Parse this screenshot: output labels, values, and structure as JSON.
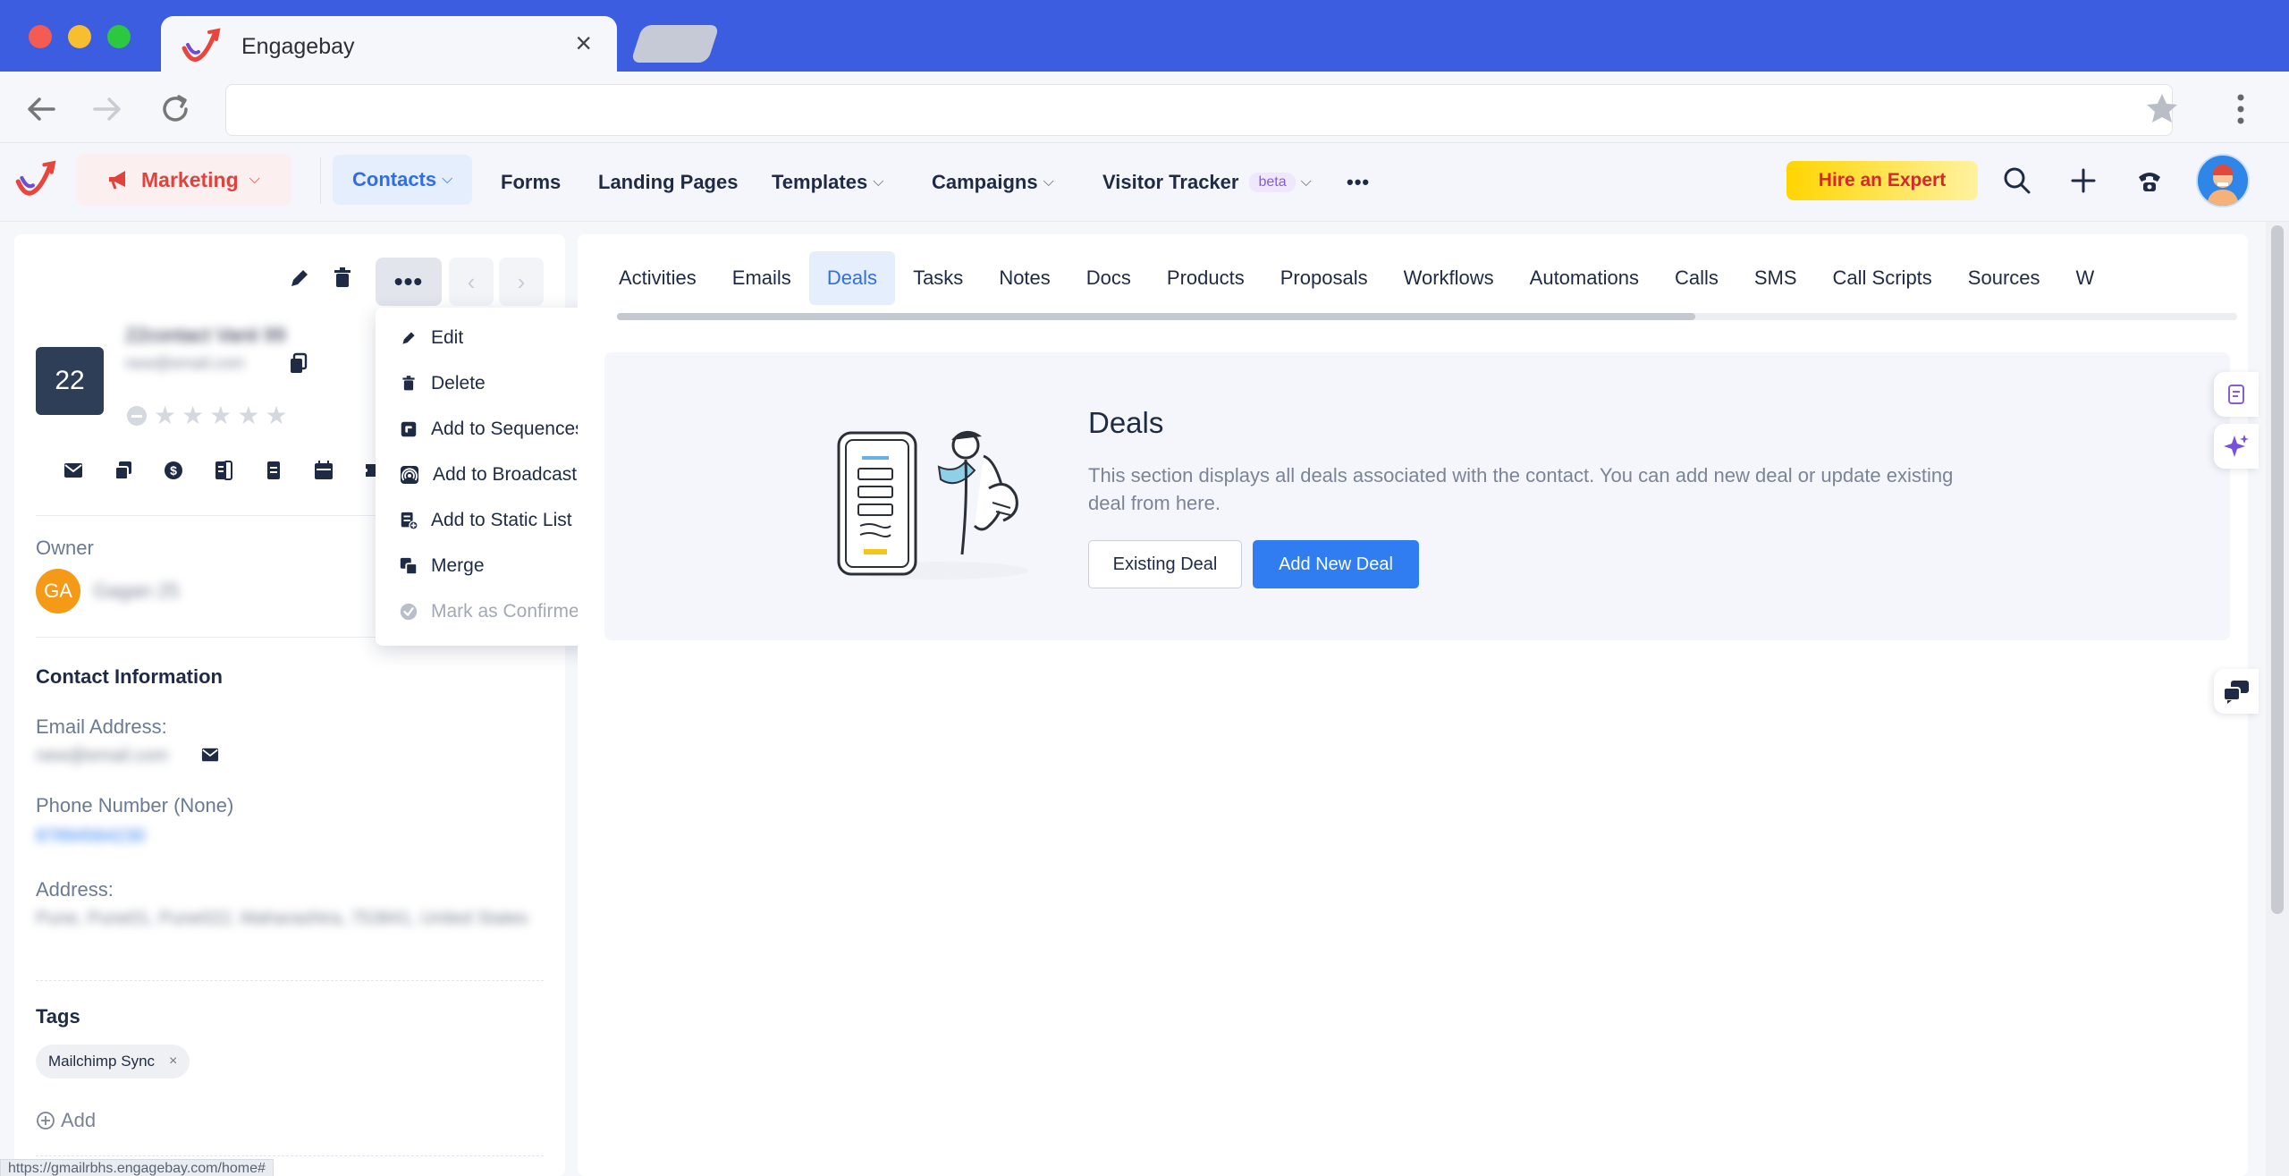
{
  "browser": {
    "tab_title": "Engagebay",
    "close_glyph": "×",
    "url": ""
  },
  "topnav": {
    "module": "Marketing",
    "items": [
      {
        "label": "Contacts",
        "dropdown": true,
        "active": true
      },
      {
        "label": "Forms",
        "dropdown": false
      },
      {
        "label": "Landing Pages",
        "dropdown": false
      },
      {
        "label": "Templates",
        "dropdown": true
      },
      {
        "label": "Campaigns",
        "dropdown": true
      },
      {
        "label": "Visitor Tracker",
        "dropdown": true,
        "badge": "beta"
      }
    ],
    "more": "•••",
    "hire_expert": "Hire an Expert"
  },
  "contact": {
    "badge": "22",
    "name": "22contact Vanii 99",
    "email": "new@email.com",
    "owner_label": "Owner",
    "owner_initials": "GA",
    "owner_name": "Gagan 25",
    "section_title": "Contact Information",
    "email_label": "Email Address:",
    "email_value": "new@email.com",
    "phone_label": "Phone Number (None)",
    "phone_value": "87894564230",
    "address_label": "Address:",
    "address_value": "Pune, Pune01, Pune022, Maharashtra, 753841, United States",
    "tags_title": "Tags",
    "tags": [
      {
        "label": "Mailchimp Sync",
        "remove": "×"
      }
    ],
    "add_label": "Add"
  },
  "more_menu": {
    "label": "•••",
    "items": [
      {
        "label": "Edit",
        "icon": "pencil-icon"
      },
      {
        "label": "Delete",
        "icon": "trash-icon"
      },
      {
        "label": "Add to Sequences",
        "icon": "sequence-icon"
      },
      {
        "label": "Add to Broadcast",
        "icon": "broadcast-icon"
      },
      {
        "label": "Add to Static List",
        "icon": "static-list-icon"
      },
      {
        "label": "Merge",
        "icon": "merge-icon"
      },
      {
        "label": "Mark as Confirmed",
        "icon": "check-circle-icon",
        "disabled": true
      }
    ]
  },
  "tabs": [
    "Activities",
    "Emails",
    "Deals",
    "Tasks",
    "Notes",
    "Docs",
    "Products",
    "Proposals",
    "Workflows",
    "Automations",
    "Calls",
    "SMS",
    "Call Scripts",
    "Sources",
    "W"
  ],
  "active_tab": "Deals",
  "deals": {
    "title": "Deals",
    "description": "This section displays all deals associated with the contact. You can add new deal or update existing deal from here.",
    "existing_button": "Existing Deal",
    "new_button": "Add New Deal"
  },
  "status_url": "https://gmailrbhs.engagebay.com/home#",
  "colors": {
    "brand_blue": "#3d5de0",
    "accent": "#2f7df0",
    "marketing": "#e0433b",
    "owner_badge": "#f49a16"
  }
}
